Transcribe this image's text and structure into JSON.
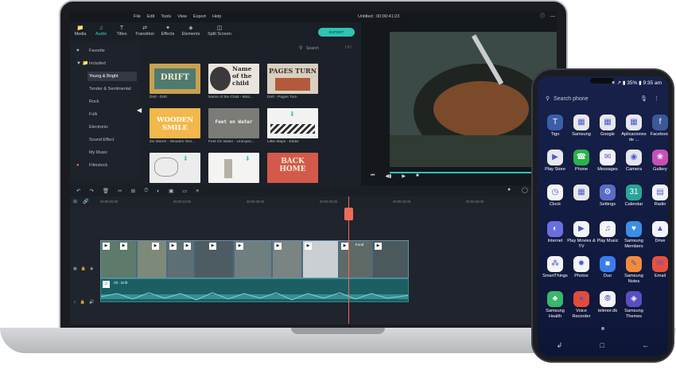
{
  "editor": {
    "menu": [
      "File",
      "Edit",
      "Tools",
      "View",
      "Export",
      "Help"
    ],
    "title": "Untitled : 00:00:41:23",
    "tabs": [
      {
        "label": "Media",
        "icon": "folder-icon"
      },
      {
        "label": "Audio",
        "icon": "music-note-icon"
      },
      {
        "label": "Titles",
        "icon": "text-t-icon"
      },
      {
        "label": "Transition",
        "icon": "transition-icon"
      },
      {
        "label": "Effects",
        "icon": "effects-icon"
      },
      {
        "label": "Elements",
        "icon": "elements-icon"
      },
      {
        "label": "Split Screen",
        "icon": "split-screen-icon"
      }
    ],
    "export_label": "EXPORT",
    "search_placeholder": "Search",
    "sidebar": {
      "favorite": "Favorite",
      "included": "Included",
      "categories": [
        "Young & Bright",
        "Tender & Sentimental",
        "Rock",
        "Folk",
        "Electronic",
        "Sound Effect",
        "My Music"
      ],
      "filmstock": "Filmstock"
    },
    "thumbnails": [
      {
        "caption": "Drift - Drift",
        "text": "DRIFT"
      },
      {
        "caption": "Name of the Child - Moti...",
        "text": "Name of the child"
      },
      {
        "caption": "Drift - Pages Turn",
        "text": "PAGES TURN"
      },
      {
        "caption": "Ziv Moren - Wooden Smi...",
        "text": "WOODEN SMILE"
      },
      {
        "caption": "Feet On Water - Unexpec...",
        "text": "Feet on Water"
      },
      {
        "caption": "Little Maps - Eddie",
        "text": ""
      },
      {
        "caption": "",
        "text": ""
      },
      {
        "caption": "",
        "text": "BACK HOME"
      },
      {
        "caption": "",
        "text": ""
      }
    ],
    "ruler_labels": [
      "00:00:00:00",
      "00:00:10:00",
      "00:00:20:00",
      "00:00:30:00",
      "00:00:40:00",
      "00:00:50:00"
    ],
    "audio_clip_label": "rift - Drift",
    "clip_label": "Food"
  },
  "phone": {
    "status": "✶ ↗ ▮ 35% ▮ 9:35 am",
    "search_placeholder": "Search phone",
    "apps": [
      {
        "name": "Tigo",
        "color": "#3b5ea8",
        "icon": "tigo-icon"
      },
      {
        "name": "Samsung",
        "color": "#e8e8ec",
        "icon": "samsung-folder-icon"
      },
      {
        "name": "Google",
        "color": "#e8e8ec",
        "icon": "google-folder-icon"
      },
      {
        "name": "Aplicaciones de ...",
        "color": "#e8e8ec",
        "icon": "apps-folder-icon"
      },
      {
        "name": "Facebook",
        "color": "#3b5998",
        "icon": "facebook-icon"
      },
      {
        "name": "Play Store",
        "color": "#e8e8ec",
        "icon": "play-store-icon"
      },
      {
        "name": "Phone",
        "color": "#29b34a",
        "icon": "phone-icon"
      },
      {
        "name": "Messages",
        "color": "#f1f1f4",
        "icon": "messages-icon"
      },
      {
        "name": "Camera",
        "color": "#e6e6ea",
        "icon": "camera-icon"
      },
      {
        "name": "Gallery",
        "color": "#c64fb8",
        "icon": "gallery-icon"
      },
      {
        "name": "Clock",
        "color": "#f4f4f4",
        "icon": "clock-icon"
      },
      {
        "name": "",
        "color": "#e8e8ec",
        "icon": "blank-folder-icon"
      },
      {
        "name": "Settings",
        "color": "#5c6cc4",
        "icon": "settings-icon"
      },
      {
        "name": "Calendar",
        "color": "#2aa59a",
        "icon": "calendar-icon"
      },
      {
        "name": "Radio",
        "color": "#f4f4f4",
        "icon": "radio-icon"
      },
      {
        "name": "Internet",
        "color": "#6a6fe0",
        "icon": "internet-icon"
      },
      {
        "name": "Play Movies & TV",
        "color": "#f4f4f4",
        "icon": "play-movies-icon"
      },
      {
        "name": "Play Music",
        "color": "#f4f4f4",
        "icon": "play-music-icon"
      },
      {
        "name": "Samsung Members",
        "color": "#3a8fe6",
        "icon": "samsung-members-icon"
      },
      {
        "name": "Drive",
        "color": "#f4f4f4",
        "icon": "drive-icon"
      },
      {
        "name": "SmartThings",
        "color": "#f4f4f4",
        "icon": "smartthings-icon"
      },
      {
        "name": "Photos",
        "color": "#f4f4f4",
        "icon": "photos-icon"
      },
      {
        "name": "Duo",
        "color": "#3a7cf0",
        "icon": "duo-icon"
      },
      {
        "name": "Samsung Notes",
        "color": "#f48a3a",
        "icon": "notes-icon"
      },
      {
        "name": "Email",
        "color": "#e8503e",
        "icon": "email-icon"
      },
      {
        "name": "Samsung Health",
        "color": "#38b86a",
        "icon": "health-icon"
      },
      {
        "name": "Voice Recorder",
        "color": "#e34b3b",
        "icon": "voice-recorder-icon"
      },
      {
        "name": "telenor.dk",
        "color": "#f4f4f4",
        "icon": "telenor-icon"
      },
      {
        "name": "Samsung Themes",
        "color": "#5a4ec4",
        "icon": "themes-icon"
      }
    ],
    "nav": [
      "↲",
      "□",
      "←"
    ]
  }
}
